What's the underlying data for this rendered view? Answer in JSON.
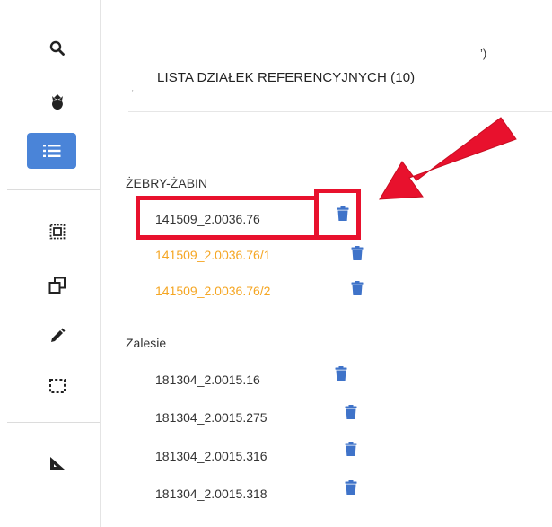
{
  "panel": {
    "title": "LISTA DZIAŁEK REFERENCYJNYCH (10)",
    "title_artifact": "’)",
    "dot_artifact": "ˑ"
  },
  "toolbar": {
    "items": [
      {
        "icon": "search-icon"
      },
      {
        "icon": "plant-icon"
      },
      {
        "icon": "list-icon",
        "active": true
      },
      {
        "icon": "dotted-square-select-icon"
      },
      {
        "icon": "overlapping-squares-icon"
      },
      {
        "icon": "pencil-icon"
      },
      {
        "icon": "dashed-rectangle-icon"
      },
      {
        "icon": "ruler-triangle-icon"
      }
    ]
  },
  "groups": [
    {
      "name": "ŻEBRY-ŻABIN",
      "parcels": [
        {
          "id": "141509_2.0036.76",
          "color": "default",
          "highlighted": true
        },
        {
          "id": "141509_2.0036.76/1",
          "color": "orange"
        },
        {
          "id": "141509_2.0036.76/2",
          "color": "orange"
        }
      ]
    },
    {
      "name": "Zalesie",
      "parcels": [
        {
          "id": "181304_2.0015.16",
          "color": "default"
        },
        {
          "id": "181304_2.0015.275",
          "color": "default"
        },
        {
          "id": "181304_2.0015.316",
          "color": "default"
        },
        {
          "id": "181304_2.0015.318",
          "color": "default"
        }
      ]
    }
  ],
  "colors": {
    "accent": "#4a84d8",
    "trash": "#3f73c9",
    "orange_text": "#f5a623",
    "highlight": "#e8112d"
  }
}
